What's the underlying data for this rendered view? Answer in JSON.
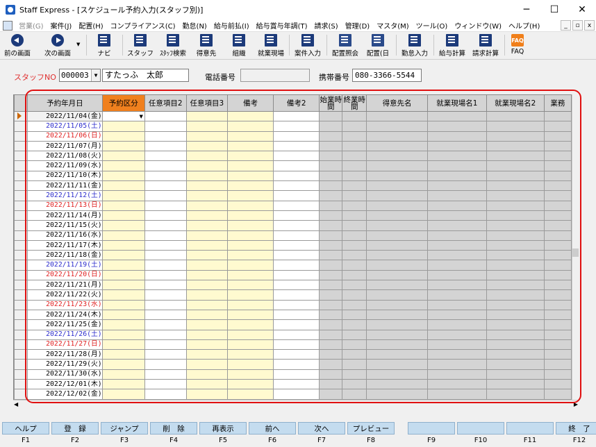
{
  "window": {
    "title": "Staff Express - [スケジュール予約入力(スタッフ別)]",
    "buttons": [
      "─",
      "☐",
      "✕"
    ],
    "mdi_buttons": [
      "_",
      "▫",
      "x"
    ]
  },
  "menu": [
    {
      "label": "営業(G)",
      "disabled": true
    },
    {
      "label": "案件(J)"
    },
    {
      "label": "配置(H)"
    },
    {
      "label": "コンプライアンス(C)"
    },
    {
      "label": "勤怠(N)"
    },
    {
      "label": "給与前払(I)"
    },
    {
      "label": "給与賞与年調(T)"
    },
    {
      "label": "請求(S)"
    },
    {
      "label": "管理(D)"
    },
    {
      "label": "マスタ(M)"
    },
    {
      "label": "ツール(O)"
    },
    {
      "label": "ウィンドウ(W)"
    },
    {
      "label": "ヘルプ(H)"
    }
  ],
  "toolbar": {
    "prev": "前の画面",
    "next": "次の画面",
    "navi": "ナビ",
    "staff": "スタッフ",
    "staff_search": "ｽﾀｯﾌ検索",
    "client": "得意先",
    "org": "組織",
    "worksite": "就業現場",
    "job_entry": "案件入力",
    "assign_query": "配置照会",
    "assign_day": "配置(日",
    "attendance": "勤怠入力",
    "payroll": "給与計算",
    "billing": "請求計算",
    "faq": "FAQ",
    "faq_icon_text": "FAQ"
  },
  "form": {
    "staff_no_label": "スタッフNO",
    "staff_no": "000003",
    "staff_name": "すたっふ　太郎",
    "phone_label": "電話番号",
    "phone": "",
    "mobile_label": "携帯番号",
    "mobile": "080-3366-5544"
  },
  "grid": {
    "columns": [
      "予約年月日",
      "予約区分",
      "任意項目2",
      "任意項目3",
      "備考",
      "備考2",
      "始業時間",
      "終業時間",
      "得意先名",
      "就業現場名1",
      "就業現場名2",
      "業務"
    ],
    "rows": [
      {
        "date": "2022/11/04(金)",
        "day": "weekday"
      },
      {
        "date": "2022/11/05(土)",
        "day": "sat"
      },
      {
        "date": "2022/11/06(日)",
        "day": "sun"
      },
      {
        "date": "2022/11/07(月)",
        "day": "weekday"
      },
      {
        "date": "2022/11/08(火)",
        "day": "weekday"
      },
      {
        "date": "2022/11/09(水)",
        "day": "weekday"
      },
      {
        "date": "2022/11/10(木)",
        "day": "weekday"
      },
      {
        "date": "2022/11/11(金)",
        "day": "weekday"
      },
      {
        "date": "2022/11/12(土)",
        "day": "sat"
      },
      {
        "date": "2022/11/13(日)",
        "day": "sun"
      },
      {
        "date": "2022/11/14(月)",
        "day": "weekday"
      },
      {
        "date": "2022/11/15(火)",
        "day": "weekday"
      },
      {
        "date": "2022/11/16(水)",
        "day": "weekday"
      },
      {
        "date": "2022/11/17(木)",
        "day": "weekday"
      },
      {
        "date": "2022/11/18(金)",
        "day": "weekday"
      },
      {
        "date": "2022/11/19(土)",
        "day": "sat"
      },
      {
        "date": "2022/11/20(日)",
        "day": "sun"
      },
      {
        "date": "2022/11/21(月)",
        "day": "weekday"
      },
      {
        "date": "2022/11/22(火)",
        "day": "weekday"
      },
      {
        "date": "2022/11/23(水)",
        "day": "sun"
      },
      {
        "date": "2022/11/24(木)",
        "day": "weekday"
      },
      {
        "date": "2022/11/25(金)",
        "day": "weekday"
      },
      {
        "date": "2022/11/26(土)",
        "day": "sat"
      },
      {
        "date": "2022/11/27(日)",
        "day": "sun"
      },
      {
        "date": "2022/11/28(月)",
        "day": "weekday"
      },
      {
        "date": "2022/11/29(火)",
        "day": "weekday"
      },
      {
        "date": "2022/11/30(水)",
        "day": "weekday"
      },
      {
        "date": "2022/12/01(木)",
        "day": "weekday"
      },
      {
        "date": "2022/12/02(金)",
        "day": "weekday"
      }
    ]
  },
  "fkeys": [
    {
      "label": "ヘルプ",
      "key": "F1"
    },
    {
      "label": "登　録",
      "key": "F2"
    },
    {
      "label": "ジャンプ",
      "key": "F3"
    },
    {
      "label": "削　除",
      "key": "F4"
    },
    {
      "label": "再表示",
      "key": "F5"
    },
    {
      "label": "前へ",
      "key": "F6"
    },
    {
      "label": "次へ",
      "key": "F7"
    },
    {
      "label": "プレビュー",
      "key": "F8"
    },
    {
      "label": "",
      "key": "F9"
    },
    {
      "label": "",
      "key": "F10"
    },
    {
      "label": "",
      "key": "F11"
    },
    {
      "label": "終　了",
      "key": "F12"
    }
  ],
  "colors": {
    "accent_orange": "#f0801e",
    "highlight_red": "#e01010",
    "saturday": "#2a2acb",
    "sunday": "#e02020",
    "cell_yellow": "#fffad0"
  }
}
